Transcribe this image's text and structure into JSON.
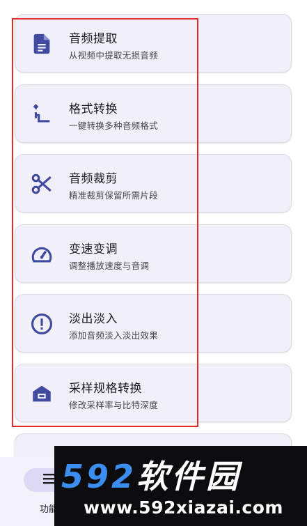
{
  "features": [
    {
      "title": "音频提取",
      "subtitle": "从视频中提取无损音频",
      "icon": "document-icon"
    },
    {
      "title": "格式转换",
      "subtitle": "一键转换多种音频格式",
      "icon": "convert-icon"
    },
    {
      "title": "音频裁剪",
      "subtitle": "精准裁剪保留所需片段",
      "icon": "scissors-icon"
    },
    {
      "title": "变速变调",
      "subtitle": "调整播放速度与音调",
      "icon": "speedometer-icon"
    },
    {
      "title": "淡出淡入",
      "subtitle": "添加音频淡入淡出效果",
      "icon": "info-circle-icon"
    },
    {
      "title": "采样规格转换",
      "subtitle": "修改采样率与比特深度",
      "icon": "archive-icon"
    }
  ],
  "bottom_nav": {
    "active_label": "功能"
  },
  "watermark": {
    "brand_num": "592",
    "brand_text": "软件园",
    "url": "www.592xiazai.com"
  },
  "colors": {
    "accent": "#3f4aa0",
    "highlight_box": "#e02b2b",
    "card_bg": "#f1eff8"
  }
}
